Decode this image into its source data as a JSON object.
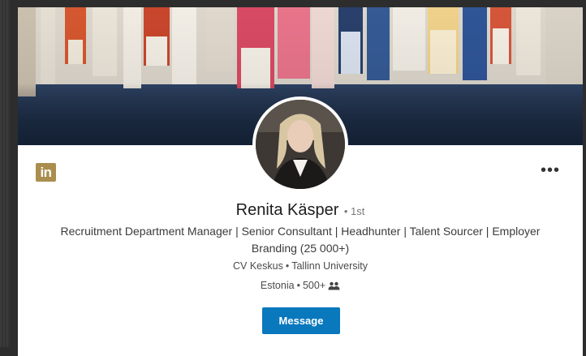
{
  "profile": {
    "name": "Renita Käsper",
    "degree": "• 1st",
    "headline": "Recruitment Department Manager | Senior Consultant | Headhunter | Talent Sourcer | Employer Branding (25 000+)",
    "company": "CV Keskus",
    "school": "Tallinn University",
    "location": "Estonia",
    "connections": "500+"
  },
  "brand": {
    "logo_text": "in",
    "logo_color": "#a98e4e"
  },
  "actions": {
    "message_label": "Message",
    "more_label": "•••",
    "accent": "#0a78bd"
  },
  "separators": {
    "dot": "•"
  },
  "icons": [
    "linkedin-logo-icon",
    "more-options-icon",
    "connections-icon"
  ]
}
